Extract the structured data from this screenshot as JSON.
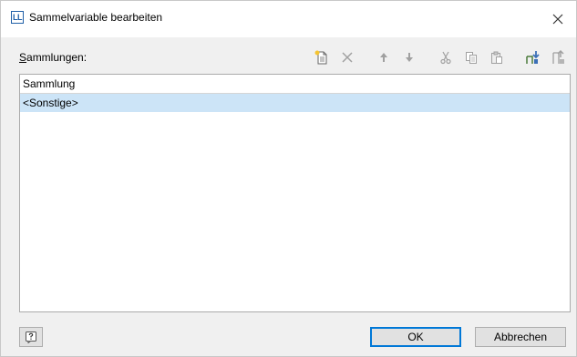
{
  "window": {
    "title": "Sammelvariable bearbeiten",
    "app_icon_text": "LL"
  },
  "collections": {
    "label_accel": "S",
    "label_rest": "ammlungen:",
    "column_header": "Sammlung",
    "items": [
      {
        "label": "<Sonstige>",
        "selected": true
      }
    ]
  },
  "toolbar": {
    "icons": [
      "new-item-icon",
      "delete-icon",
      "move-up-icon",
      "move-down-icon",
      "cut-icon",
      "copy-icon",
      "paste-icon",
      "insert-variable-icon",
      "remove-variable-icon"
    ]
  },
  "footer": {
    "ok_label": "OK",
    "cancel_label": "Abbrechen"
  },
  "colors": {
    "selection": "#cce4f7",
    "accent": "#0078d7"
  }
}
